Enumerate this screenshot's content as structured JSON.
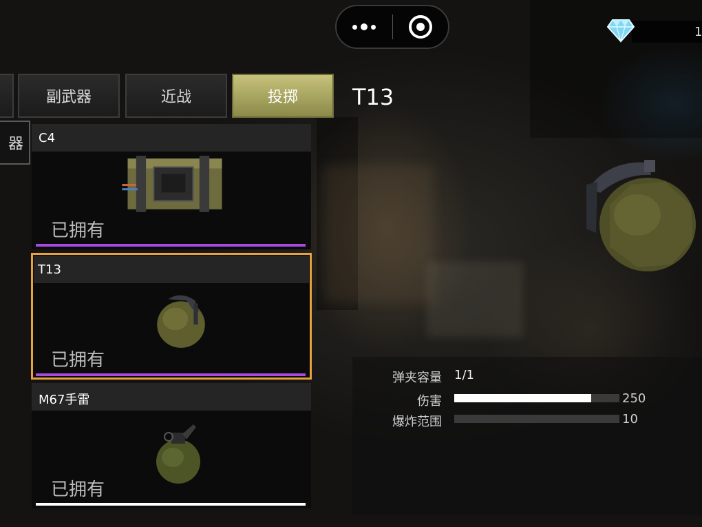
{
  "hud": {
    "menu_icon": "more-dots-icon",
    "close_icon": "target-circle-icon",
    "currency_icon": "diamond-icon",
    "currency_value": "1"
  },
  "tabs": [
    {
      "label": "",
      "active": false
    },
    {
      "label": "副武器",
      "active": false
    },
    {
      "label": "近战",
      "active": false
    },
    {
      "label": "投掷",
      "active": true
    }
  ],
  "side_tab": {
    "label": "器"
  },
  "selected_item": {
    "name": "T13"
  },
  "items": [
    {
      "name": "C4",
      "status": "已拥有",
      "bar_color": "#a64ae0",
      "selected": false
    },
    {
      "name": "T13",
      "status": "已拥有",
      "bar_color": "#a64ae0",
      "selected": true
    },
    {
      "name": "M67手雷",
      "status": "已拥有",
      "bar_color": "#ffffff",
      "selected": false
    }
  ],
  "stats": {
    "magazine": {
      "label": "弹夹容量",
      "value": "1/1"
    },
    "damage": {
      "label": "伤害",
      "value": "250",
      "fill_fraction": 0.83
    },
    "blast_radius": {
      "label": "爆炸范围",
      "value": "10",
      "fill_fraction": 0.0
    }
  },
  "colors": {
    "accent_active_tab": "#b3af66",
    "selection_border": "#e8a13e"
  }
}
